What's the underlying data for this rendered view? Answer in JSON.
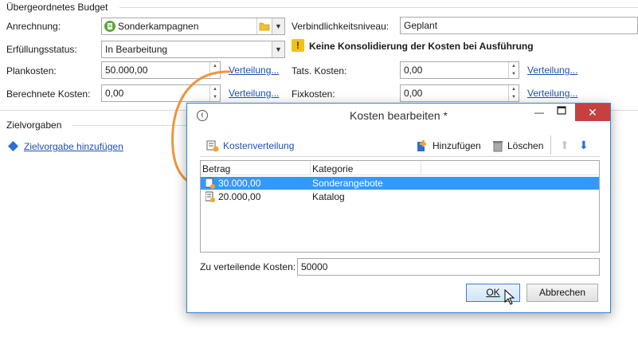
{
  "budget": {
    "section_title": "Übergeordnetes Budget",
    "anrechnung_label": "Anrechnung:",
    "anrechnung_value": "Sonderkampagnen",
    "status_label": "Erfüllungsstatus:",
    "status_value": "In Bearbeitung",
    "plankosten_label": "Plankosten:",
    "plankosten_value": "50.000,00",
    "berechnete_label": "Berechnete Kosten:",
    "berechnete_value": "0,00",
    "verteilung_link": "Verteilung...",
    "verbindlichkeit_label": "Verbindlichkeitsniveau:",
    "verbindlichkeit_value": "Geplant",
    "warning_text": "Keine Konsolidierung der Kosten bei Ausführung",
    "tats_label": "Tats. Kosten:",
    "tats_value": "0,00",
    "fix_label": "Fixkosten:",
    "fix_value": "0,00"
  },
  "ziel": {
    "section_title": "Zielvorgaben",
    "add_link": "Zielvorgabe hinzufügen"
  },
  "dialog": {
    "title": "Kosten bearbeiten *",
    "toolbar": {
      "kostenverteilung": "Kostenverteilung",
      "hinzufuegen": "Hinzufügen",
      "loeschen": "Löschen"
    },
    "columns": [
      "Betrag",
      "Kategorie"
    ],
    "rows": [
      {
        "betrag": "30.000,00",
        "kategorie": "Sonderangebote",
        "selected": true
      },
      {
        "betrag": "20.000,00",
        "kategorie": "Katalog",
        "selected": false
      }
    ],
    "zu_verteilende_label": "Zu verteilende Kosten:",
    "zu_verteilende_value": "50000",
    "ok_label": "OK",
    "abbrechen_label": "Abbrechen"
  },
  "colors": {
    "selection": "#3399ff",
    "link": "#1d4fb6",
    "arrow": "#f0953c",
    "dialog_border": "#2e86d6",
    "close_button": "#c74040"
  }
}
